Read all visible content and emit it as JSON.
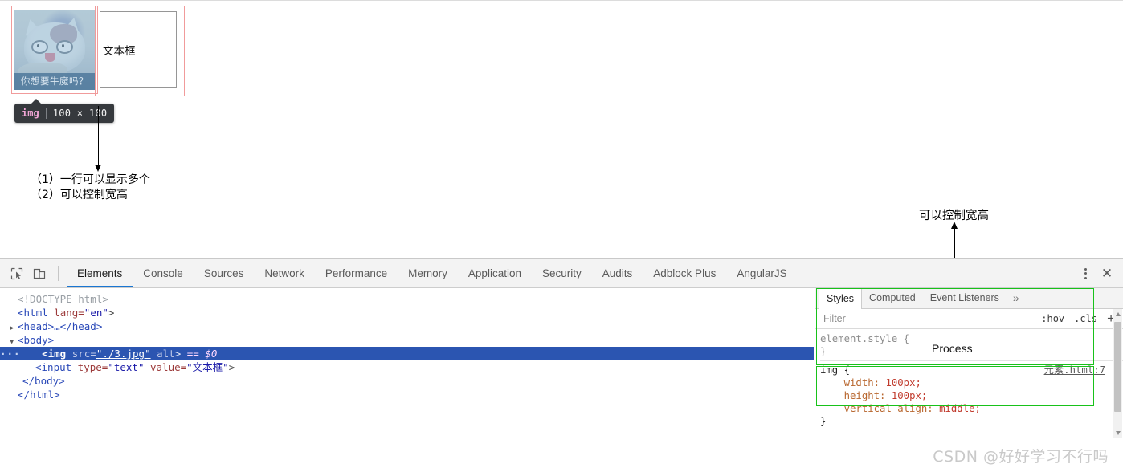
{
  "page": {
    "image": {
      "caption": "你想要牛魔吗？",
      "alt": ""
    },
    "textbox": {
      "value": "文本框",
      "placeholder": ""
    },
    "highlight_tooltip": {
      "tag": "img",
      "dimensions": "100 × 100"
    }
  },
  "annotations": {
    "left_note_line1": "（1）一行可以显示多个",
    "left_note_line2": "（2）可以控制宽高",
    "right_note": "可以控制宽高",
    "process_label": "Process",
    "red_color": "#f19b9b",
    "green_color": "#18c21a",
    "arrow_color": "#000000"
  },
  "devtools": {
    "toolbar": {
      "inspect_icon": "inspect-element-icon",
      "device_icon": "device-toolbar-icon",
      "kebab_icon": "more-options-icon",
      "close_icon": "close-icon"
    },
    "tabs": [
      {
        "label": "Elements",
        "active": true
      },
      {
        "label": "Console",
        "active": false
      },
      {
        "label": "Sources",
        "active": false
      },
      {
        "label": "Network",
        "active": false
      },
      {
        "label": "Performance",
        "active": false
      },
      {
        "label": "Memory",
        "active": false
      },
      {
        "label": "Application",
        "active": false
      },
      {
        "label": "Security",
        "active": false
      },
      {
        "label": "Audits",
        "active": false
      },
      {
        "label": "Adblock Plus",
        "active": false
      },
      {
        "label": "AngularJS",
        "active": false
      }
    ],
    "elements_code": {
      "l1_doctype": "<!DOCTYPE html>",
      "l2_html_open_tag": "<html",
      "l2_attr": " lang=",
      "l2_val": "\"en\"",
      "l2_close": ">",
      "l3_head": "<head>…</head>",
      "l4_body_open": "<body>",
      "l5_ellipsis": "···",
      "l5_tag_open": "<img",
      "l5_attr_src": " src=",
      "l5_val_src": "\"./3.jpg\"",
      "l5_attr_alt": " alt",
      "l5_close": ">",
      "l5_selection": " == $0",
      "l6_tag_open": "<input",
      "l6_attr_type": " type=",
      "l6_val_type": "\"text\"",
      "l6_attr_value": " value=",
      "l6_val_value": "\"文本框\"",
      "l6_close": ">",
      "l7_body_close": "</body>",
      "l8_html_close": "</html>"
    },
    "styles": {
      "tabs": [
        {
          "label": "Styles",
          "active": true
        },
        {
          "label": "Computed",
          "active": false
        },
        {
          "label": "Event Listeners",
          "active": false
        }
      ],
      "more_tabs_icon": "»",
      "filter_placeholder": "Filter",
      "hov_button": ":hov",
      "cls_button": ".cls",
      "plus_button": "+",
      "rules": [
        {
          "selector": "element.style {",
          "close": "}",
          "source": "",
          "declarations": []
        },
        {
          "selector": "img {",
          "close": "}",
          "source": "元素.html:7",
          "declarations": [
            {
              "name": "width",
              "value": "100px;"
            },
            {
              "name": "height",
              "value": "100px;"
            },
            {
              "name": "vertical-align",
              "value": "middle;"
            }
          ]
        }
      ]
    }
  },
  "watermark": "CSDN @好好学习不行吗"
}
